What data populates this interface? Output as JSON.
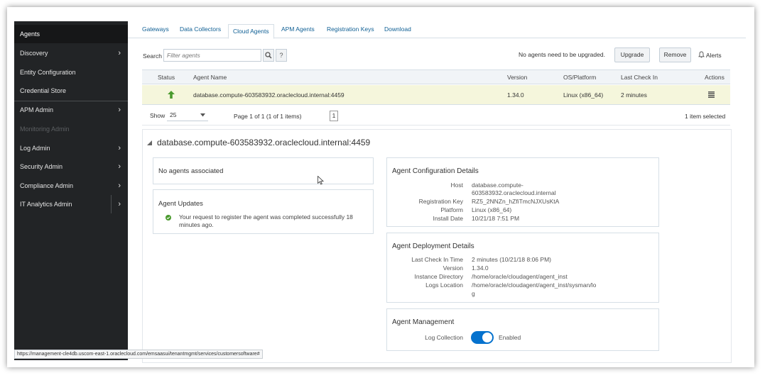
{
  "sidebar": {
    "items": [
      {
        "label": "Agents",
        "has_chevron": false
      },
      {
        "label": "Discovery",
        "has_chevron": true
      },
      {
        "label": "Entity Configuration",
        "has_chevron": false
      },
      {
        "label": "Credential Store",
        "has_chevron": false
      },
      {
        "label": "APM Admin",
        "has_chevron": true
      },
      {
        "label": "Monitoring Admin",
        "has_chevron": false
      },
      {
        "label": "Log Admin",
        "has_chevron": true
      },
      {
        "label": "Security Admin",
        "has_chevron": true
      },
      {
        "label": "Compliance Admin",
        "has_chevron": true
      },
      {
        "label": "IT Analytics Admin",
        "has_chevron": true
      }
    ],
    "chevron": "›"
  },
  "tabs": [
    "Gateways",
    "Data Collectors",
    "Cloud Agents",
    "APM Agents",
    "Registration Keys",
    "Download"
  ],
  "toolbar": {
    "search_label": "Search",
    "search_placeholder": "Filter agents",
    "search_icon": "magnifier-icon",
    "help_label": "?",
    "upgrade_status": "No agents need to be upgraded.",
    "upgrade_button": "Upgrade",
    "remove_button": "Remove",
    "alerts_label": "Alerts",
    "alerts_icon": "bell-icon"
  },
  "table": {
    "headers": {
      "status": "Status",
      "name": "Agent Name",
      "version": "Version",
      "os": "OS/Platform",
      "checkin": "Last Check In",
      "actions": "Actions"
    },
    "rows": [
      {
        "status_icon": "up-arrow-icon",
        "name": "database.compute-603583932.oraclecloud.internal:4459",
        "version": "1.34.0",
        "os": "Linux (x86_64)",
        "checkin": "2 minutes",
        "actions_icon": "menu-icon"
      }
    ]
  },
  "pager": {
    "show_label": "Show",
    "show_value": "25",
    "page_text": "Page  1  of 1  (1 of 1 items)",
    "page_button": "1",
    "selection_text": "1 item selected"
  },
  "detail": {
    "title": "database.compute-603583932.oraclecloud.internal:4459",
    "associated": "No agents associated",
    "updates": {
      "title": "Agent Updates",
      "message_line1": "Your request to register the agent was completed successfully 18",
      "message_line2": "minutes ago."
    },
    "config": {
      "title": "Agent Configuration Details",
      "host_key": "Host",
      "host_line1": "database.compute-",
      "host_line2": "603583932.oraclecloud.internal",
      "regkey_key": "Registration Key",
      "regkey_value": "RZ5_2NNZn_hZfiTmcNJXUsKtA",
      "platform_key": "Platform",
      "platform_value": "Linux (x86_64)",
      "install_key": "Install Date",
      "install_value": "10/21/18 7:51 PM"
    },
    "deployment": {
      "title": "Agent Deployment Details",
      "checkin_key": "Last Check In Time",
      "checkin_value": "2 minutes (10/21/18 8:06 PM)",
      "version_key": "Version",
      "version_value": "1.34.0",
      "instdir_key": "Instance Directory",
      "instdir_value": "/home/oracle/cloudagent/agent_inst",
      "logs_key": "Logs Location",
      "logs_line1": "/home/oracle/cloudagent/agent_inst/sysman/lo",
      "logs_line2": "g"
    },
    "management": {
      "title": "Agent Management",
      "logcollection_key": "Log Collection",
      "logcollection_value": "Enabled",
      "logcollection_on": true
    }
  },
  "statusbar": {
    "url": "https://management-cle4db.uscom-east-1.oraclecloud.com/emsaasui/tenantmgmt/services/customersoftware#"
  },
  "colors": {
    "sidebar_bg": "#222426",
    "accent": "#0572ce",
    "link": "#0f5f94",
    "selected_row": "#f5f6dc",
    "success": "#4a9a2e"
  }
}
